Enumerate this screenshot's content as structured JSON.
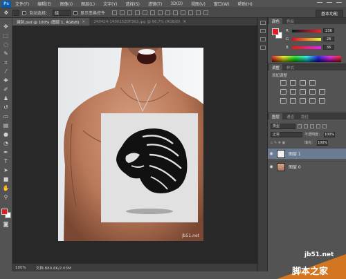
{
  "app": {
    "logo": "Ps"
  },
  "menu": [
    "文件(F)",
    "编辑(E)",
    "图像(I)",
    "图层(L)",
    "文字(Y)",
    "选择(S)",
    "滤镜(T)",
    "3D(D)",
    "视图(V)",
    "窗口(W)",
    "帮助(H)"
  ],
  "options": {
    "auto_select_label": "自动选择：",
    "auto_select_value": "组",
    "show_transform_label": "显示变换控件",
    "workspace": "基本功能"
  },
  "tabs": [
    {
      "label": "澜剑.psd @ 100% (图层 1, RGB/8)",
      "close": "×"
    },
    {
      "label": "240424-140615Z0F363.jpg @ 66.7% (RGB/8)",
      "close": "×"
    }
  ],
  "status": {
    "zoom": "100%",
    "doc": "文档:889.8K/2.03M"
  },
  "panels": {
    "color_tabs": [
      "颜色",
      "色板"
    ],
    "color": {
      "channels": [
        {
          "name": "R",
          "value": "236"
        },
        {
          "name": "G",
          "value": "28"
        },
        {
          "name": "B",
          "value": "36"
        }
      ]
    },
    "adjust_tabs": [
      "调整",
      "样式"
    ],
    "adjust_title": "添加调整",
    "layers_tabs": [
      "图层",
      "通道",
      "路径"
    ],
    "layers": {
      "filter": "类型",
      "blend": "正常",
      "opacity_label": "不透明度：",
      "opacity": "100%",
      "fill_label": "填充：",
      "fill": "100%",
      "items": [
        {
          "name": "图层 1",
          "selected": true
        },
        {
          "name": "图层 0",
          "selected": false
        }
      ]
    }
  },
  "photo_text": "jb51.net",
  "watermark": {
    "site": "jb51.net",
    "brand": "脚本之家"
  },
  "colors": {
    "foreground": "#e02020",
    "background": "#ffffff",
    "accent": "#0b5ca8"
  }
}
